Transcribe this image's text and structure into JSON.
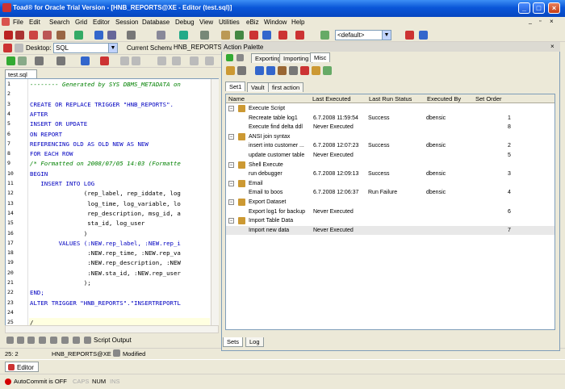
{
  "window": {
    "title": "Toad® for Oracle Trial Version - [HNB_REPORTS@XE - Editor (test.sql)]"
  },
  "menu": [
    "File",
    "Edit",
    "Search",
    "Grid",
    "Editor",
    "Session",
    "Database",
    "Debug",
    "View",
    "Utilities",
    "eBiz",
    "Window",
    "Help"
  ],
  "toolbar": {
    "desktop_label": "Desktop:",
    "desktop_value": "SQL",
    "schema_label": "Current Schema:",
    "schema_value": "HNB_REPORTS",
    "default_value": "<default>"
  },
  "editor": {
    "tab": "test.sql",
    "lines": [
      "-------- Generated by SYS DBMS_METADATA on ",
      "",
      "CREATE OR REPLACE TRIGGER \"HNB_REPORTS\".",
      "AFTER",
      "INSERT OR UPDATE",
      "ON REPORT",
      "REFERENCING OLD AS OLD NEW AS NEW",
      "FOR EACH ROW",
      "/* Formatted on 2008/07/05 14:03 (Formatte",
      "BEGIN",
      "   INSERT INTO LOG",
      "               (rep_label, rep_iddate, log",
      "                log_time, log_variable, lo",
      "                rep_description, msg_id, a",
      "                sta_id, log_user",
      "               )",
      "        VALUES (:NEW.rep_label, :NEW.rep_i",
      "                :NEW.rep_time, :NEW.rep_va",
      "                :NEW.rep_description, :NEW",
      "                :NEW.sta_id, :NEW.rep_user",
      "               );",
      "END;",
      "ALTER TRIGGER \"HNB_REPORTS\".\"INSERTREPORTL",
      "",
      "/"
    ],
    "line_numbers": [
      "1",
      "2",
      "3",
      "4",
      "5",
      "6",
      "7",
      "8",
      "9",
      "10",
      "11",
      "12",
      "13",
      "14",
      "15",
      "16",
      "17",
      "18",
      "19",
      "20",
      "21",
      "22",
      "23",
      "24",
      "25"
    ],
    "bottom_tab": "Script Output"
  },
  "palette": {
    "title": "Action Palette",
    "tabs": [
      "Exporting",
      "Importing",
      "Misc"
    ],
    "set_tabs": [
      "Set1",
      "Vault",
      "first action"
    ],
    "columns": [
      "Name",
      "Last Executed",
      "Last Run Status",
      "Executed By",
      "Set Order"
    ],
    "rows": [
      {
        "name": "Execute Script",
        "group": true,
        "last": "",
        "status": "",
        "by": "",
        "order": ""
      },
      {
        "name": "Recreate table log1",
        "group": false,
        "last": "6.7.2008 11:59:54",
        "status": "Success",
        "by": "dbensic",
        "order": "1"
      },
      {
        "name": "Execute find delta ddl",
        "group": false,
        "last": "Never Executed",
        "status": "",
        "by": "",
        "order": "8"
      },
      {
        "name": "ANSI join syntax",
        "group": true,
        "last": "",
        "status": "",
        "by": "",
        "order": ""
      },
      {
        "name": "insert into customer ...",
        "group": false,
        "last": "6.7.2008 12:07:23",
        "status": "Success",
        "by": "dbensic",
        "order": "2"
      },
      {
        "name": "update customer table",
        "group": false,
        "last": "Never Executed",
        "status": "",
        "by": "",
        "order": "5"
      },
      {
        "name": "Shell Execute",
        "group": true,
        "last": "",
        "status": "",
        "by": "",
        "order": ""
      },
      {
        "name": "run debugger",
        "group": false,
        "last": "6.7.2008 12:09:13",
        "status": "Success",
        "by": "dbensic",
        "order": "3"
      },
      {
        "name": "Email",
        "group": true,
        "last": "",
        "status": "",
        "by": "",
        "order": ""
      },
      {
        "name": "Email to boos",
        "group": false,
        "last": "6.7.2008 12:06:37",
        "status": "Run Failure",
        "by": "dbensic",
        "order": "4"
      },
      {
        "name": "Export Dataset",
        "group": true,
        "last": "",
        "status": "",
        "by": "",
        "order": ""
      },
      {
        "name": "Export log1 for backup",
        "group": false,
        "last": "Never Executed",
        "status": "",
        "by": "",
        "order": "6"
      },
      {
        "name": "Import Table Data",
        "group": true,
        "last": "",
        "status": "",
        "by": "",
        "order": ""
      },
      {
        "name": "Import new data",
        "group": false,
        "last": "Never Executed",
        "status": "",
        "by": "",
        "order": "7"
      }
    ],
    "bottom_tabs": [
      "Sets",
      "Log"
    ]
  },
  "status": {
    "position": "25:  2",
    "connection": "HNB_REPORTS@XE",
    "modified": "Modified",
    "editor_tab": "Editor",
    "autocommit": "AutoCommit is OFF",
    "caps": "CAPS",
    "num": "NUM",
    "ins": "INS"
  },
  "colors": {
    "titlebar": "#0a56d8",
    "keyword": "#0000c0",
    "string": "#c00000",
    "comment": "#008000"
  }
}
